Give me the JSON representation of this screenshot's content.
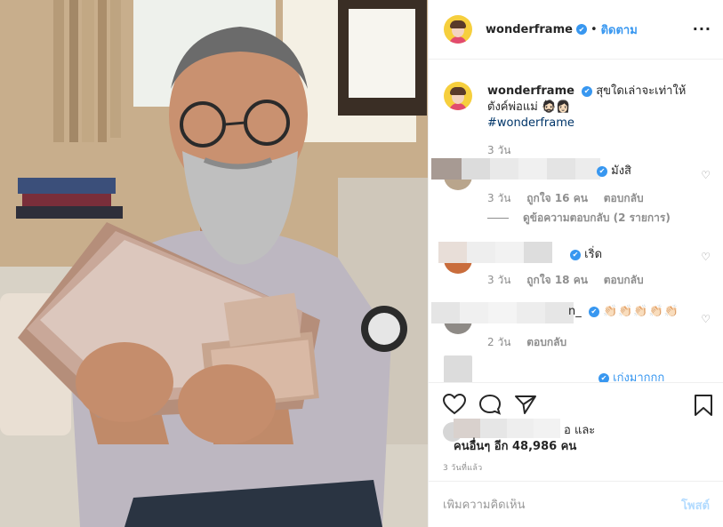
{
  "post": {
    "username": "wonderframe",
    "verified_mark": "✔",
    "follow_label": "ติดตาม",
    "more_icon": "more-horizontal-icon",
    "caption_text": "สุขใดเล่าจะเท่าให้ตังค์พ่อแม่ 🧔🏻👩🏻",
    "hashtag": "#wonderframe",
    "caption_age": "3 วัน"
  },
  "comments": [
    {
      "text": "มังสิ",
      "age": "3 วัน",
      "likes": "ถูกใจ 16 คน",
      "reply": "ตอบกลับ",
      "view_replies": "ดูข้อความตอบกลับ (2 รายการ)"
    },
    {
      "text": "เริ่ด",
      "age": "3 วัน",
      "likes": "ถูกใจ 18 คน",
      "reply": "ตอบกลับ"
    },
    {
      "name_tail": "n_",
      "text": "👏🏻👏🏻👏🏻👏🏻👏🏻",
      "age": "2 วัน",
      "reply": "ตอบกลับ"
    },
    {
      "text": "เก่งมากกก"
    }
  ],
  "likes": {
    "line1_tail": "อ และ",
    "line2": "คนอื่นๆ อีก 48,986 คน"
  },
  "timestamp": "3 วันที่แล้ว",
  "add_comment": {
    "placeholder": "เพิ่มความคิดเห็น",
    "post_label": "โพสต์"
  },
  "colors": {
    "accent": "#3897f0",
    "muted": "#8e8e8e",
    "post_disabled": "#b3dbff"
  }
}
